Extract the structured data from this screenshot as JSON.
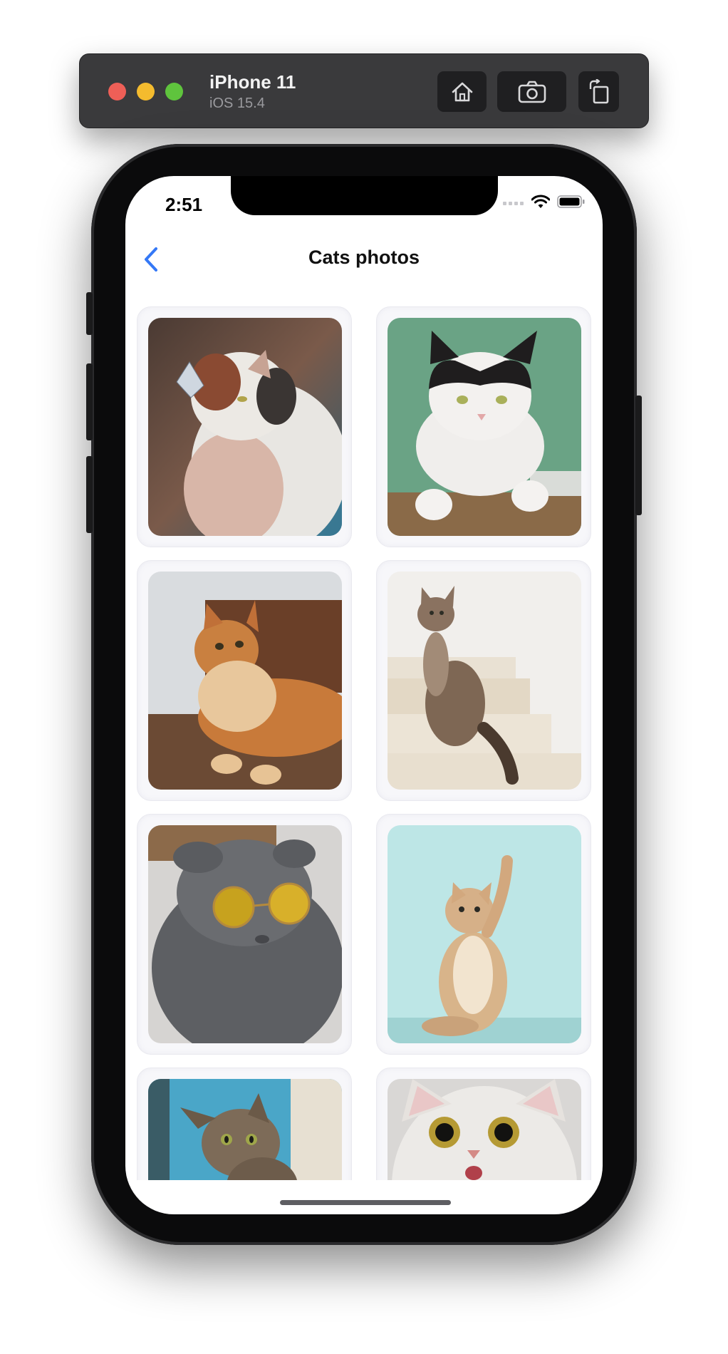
{
  "simulator": {
    "device_name": "iPhone 11",
    "os_version": "iOS 15.4",
    "buttons": [
      "home-icon",
      "screenshot-icon",
      "rotate-icon"
    ]
  },
  "status_bar": {
    "time": "2:51",
    "icons": [
      "cellular-icon",
      "wifi-icon",
      "battery-icon"
    ]
  },
  "nav": {
    "title": "Cats photos",
    "back_icon": "chevron-left-icon"
  },
  "photos": [
    {
      "label": "cat-with-butterfly"
    },
    {
      "label": "black-white-cat-on-green"
    },
    {
      "label": "ginger-cat-lying"
    },
    {
      "label": "tabby-cat-on-stairs"
    },
    {
      "label": "grey-cat-with-sunglasses"
    },
    {
      "label": "kitten-on-teal"
    },
    {
      "label": "tabby-cat-peeking"
    },
    {
      "label": "white-cat-surprised"
    }
  ],
  "colors": {
    "accent": "#3478f6",
    "card_background": "#f7f7fa"
  }
}
